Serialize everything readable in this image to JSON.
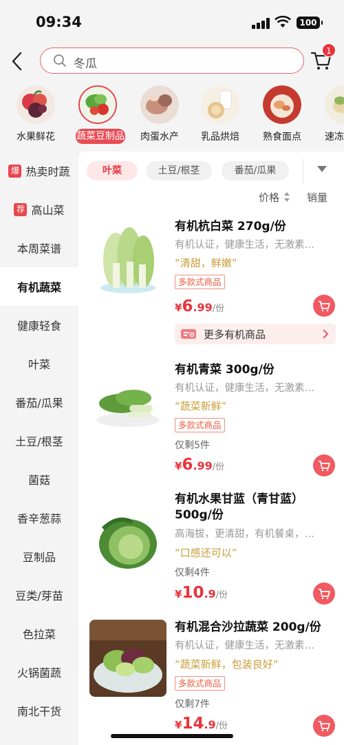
{
  "status_bar": {
    "time": "09:34",
    "battery": "100"
  },
  "search": {
    "query": "冬瓜"
  },
  "cart": {
    "badge": "1"
  },
  "categories": [
    {
      "label": "水果鲜花"
    },
    {
      "label": "蔬菜豆制品",
      "active": true
    },
    {
      "label": "肉蛋水产"
    },
    {
      "label": "乳品烘焙"
    },
    {
      "label": "熟食面点"
    },
    {
      "label": "速冻"
    }
  ],
  "sidebar": {
    "items": [
      {
        "label": "热卖时蔬",
        "tag": "爆"
      },
      {
        "label": "高山菜",
        "tag": "荐"
      },
      {
        "label": "本周菜谱"
      },
      {
        "label": "有机蔬菜",
        "active": true
      },
      {
        "label": "健康轻食"
      },
      {
        "label": "叶菜"
      },
      {
        "label": "番茄/瓜果"
      },
      {
        "label": "土豆/根茎"
      },
      {
        "label": "菌菇"
      },
      {
        "label": "香辛葱蒜"
      },
      {
        "label": "豆制品"
      },
      {
        "label": "豆类/芽苗"
      },
      {
        "label": "色拉菜"
      },
      {
        "label": "火锅菌蔬"
      },
      {
        "label": "南北干货"
      }
    ]
  },
  "filters": {
    "chips": [
      {
        "label": "叶菜",
        "active": true
      },
      {
        "label": "土豆/根茎"
      },
      {
        "label": "番茄/瓜果"
      }
    ],
    "sort_price": "价格",
    "sort_sales": "销量"
  },
  "products": [
    {
      "title": "有机杭白菜 270g/份",
      "desc": "有机认证，健康生活，无激素残留",
      "quote": "“清甜，鲜嫩”",
      "tag": "多款式商品",
      "price_int": "6",
      "price_dec": ".99",
      "unit": "/份",
      "currency": "¥"
    },
    {
      "title": "有机青菜 300g/份",
      "desc": "有机认证，健康生活，无激素残留",
      "quote": "“蔬菜新鲜”",
      "tag": "多款式商品",
      "stock": "仅剩5件",
      "price_int": "6",
      "price_dec": ".99",
      "unit": "/份",
      "currency": "¥"
    },
    {
      "title": "有机水果甘蓝（青甘蓝）500g/份",
      "desc": "高海拔，更清甜，有机餐桌，健康生活",
      "quote": "“口感还可以”",
      "stock": "仅剩4件",
      "price_int": "10",
      "price_dec": ".9",
      "unit": "/份",
      "currency": "¥"
    },
    {
      "title": "有机混合沙拉蔬菜 200g/份",
      "desc": "有机认证，健康生活，无激素残留",
      "quote": "“蔬菜新鲜，包装良好”",
      "tag": "多款式商品",
      "stock": "仅剩7件",
      "price_int": "14",
      "price_dec": ".9",
      "unit": "/份",
      "currency": "¥"
    }
  ],
  "more_banner": {
    "label": "更多有机商品"
  },
  "colors": {
    "accent": "#e8343c",
    "quote": "#c99d3a",
    "sidebar_bg": "#f4f4f4"
  }
}
